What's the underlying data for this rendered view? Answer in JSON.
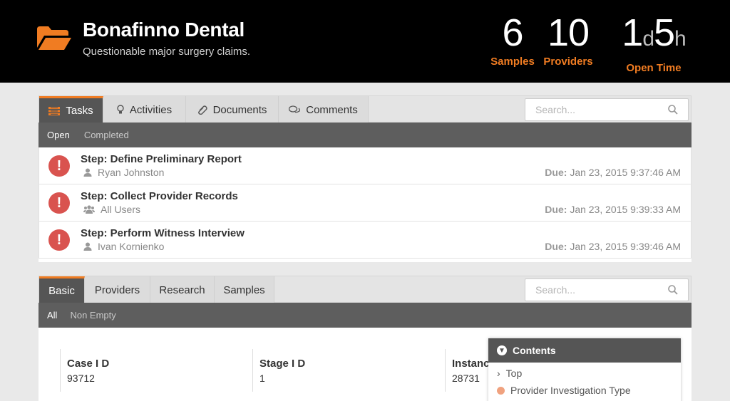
{
  "header": {
    "title": "Bonafinno Dental",
    "subtitle": "Questionable major surgery claims.",
    "stats": {
      "samples": {
        "value": "6",
        "label": "Samples"
      },
      "providers": {
        "value": "10",
        "label": "Providers"
      },
      "open_time": {
        "days": "1",
        "days_unit": "d",
        "hours": "5",
        "hours_unit": "h",
        "label": "Open Time"
      }
    },
    "accent": "#f07c22"
  },
  "tasks_panel": {
    "tabs": [
      {
        "label": "Tasks",
        "icon": "tasks-icon"
      },
      {
        "label": "Activities",
        "icon": "lightbulb-icon"
      },
      {
        "label": "Documents",
        "icon": "paperclip-icon"
      },
      {
        "label": "Comments",
        "icon": "comments-icon"
      }
    ],
    "search_placeholder": "Search...",
    "filters": [
      "Open",
      "Completed"
    ],
    "due_label": "Due:",
    "tasks": [
      {
        "title": "Step: Define Preliminary Report",
        "assignee": "Ryan Johnston",
        "assignee_icon": "user-icon",
        "due": "Jan 23, 2015 9:37:46 AM"
      },
      {
        "title": "Step: Collect Provider Records",
        "assignee": "All Users",
        "assignee_icon": "users-icon",
        "due": "Jan 23, 2015 9:39:33 AM"
      },
      {
        "title": "Step: Perform Witness Interview",
        "assignee": "Ivan Kornienko",
        "assignee_icon": "user-icon",
        "due": "Jan 23, 2015 9:39:46 AM"
      }
    ]
  },
  "details_panel": {
    "tabs": [
      "Basic",
      "Providers",
      "Research",
      "Samples"
    ],
    "search_placeholder": "Search...",
    "filters": [
      "All",
      "Non Empty"
    ],
    "fields": [
      {
        "label": "Case I D",
        "value": "93712"
      },
      {
        "label": "Stage I D",
        "value": "1"
      },
      {
        "label": "Instance I D",
        "value": "28731"
      }
    ]
  },
  "contents": {
    "title": "Contents",
    "items": [
      "Top",
      "Provider Investigation Type"
    ]
  }
}
